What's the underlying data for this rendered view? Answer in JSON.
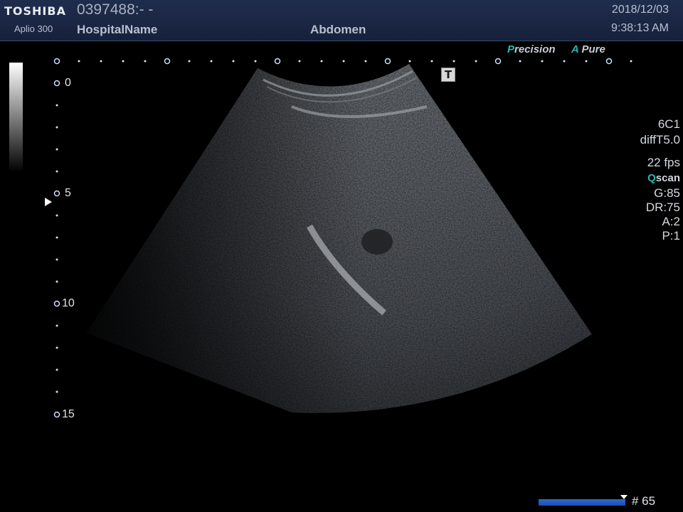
{
  "header": {
    "brand": "TOSHIBA",
    "model": "Aplio 300",
    "patient_id": "0397488:- -",
    "hospital": "HospitalName",
    "exam": "Abdomen",
    "date": "2018/12/03",
    "time": "9:38:13 AM"
  },
  "tech_badges": {
    "precision_initial": "P",
    "precision_rest": "recision",
    "apure_initial": "A",
    "apure_rest": "Pure"
  },
  "t_icon": "T",
  "depth_labels": [
    "0",
    "5",
    "10",
    "15"
  ],
  "params": {
    "probe": "6C1",
    "mode": "diffT5.0",
    "fps": "22 fps",
    "qscan_initial": "Q",
    "qscan_rest": "scan",
    "gain": "G:85",
    "dynamic_range": "DR:75",
    "a": "A:2",
    "p": "P:1"
  },
  "cine": {
    "frame": "# 65"
  },
  "colors": {
    "header_bg": "#1f2d4d",
    "accent_teal": "#2bb6b0",
    "cine_blue": "#2a6cd0"
  }
}
